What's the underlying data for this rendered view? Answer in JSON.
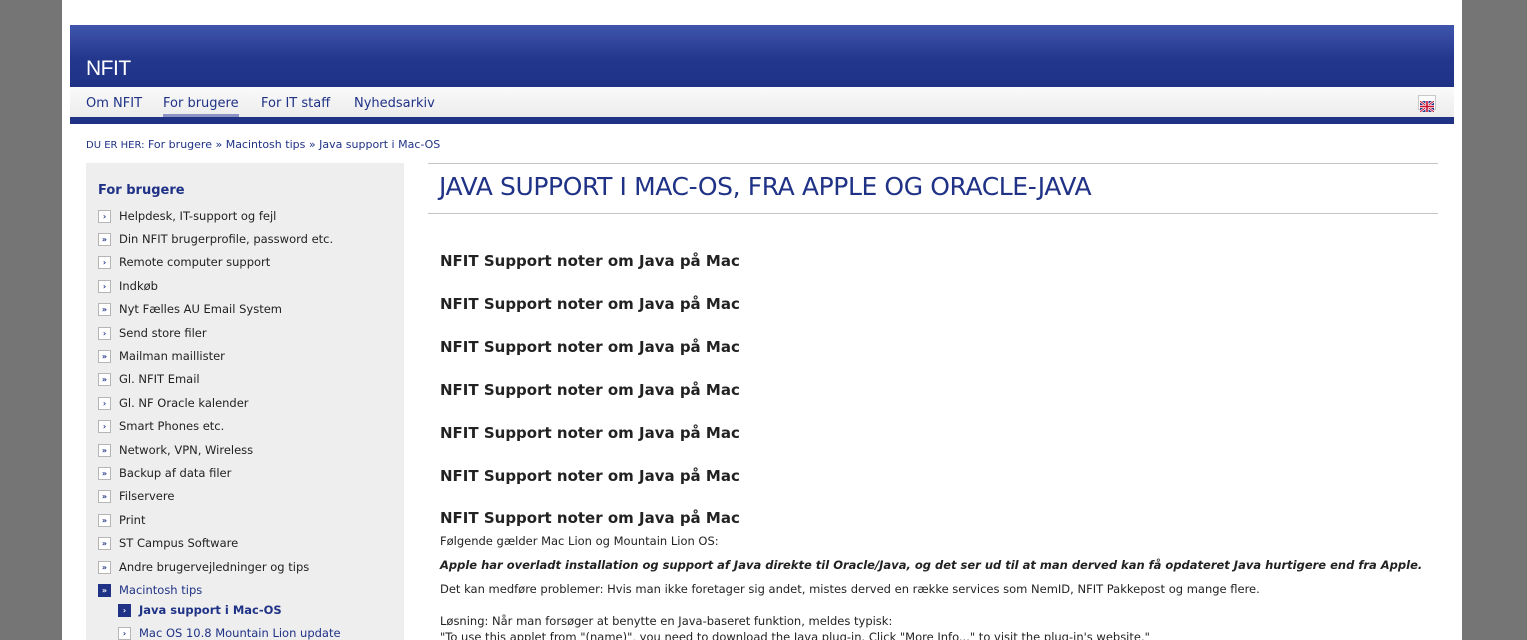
{
  "site": {
    "title": "NFIT"
  },
  "nav": {
    "items": [
      {
        "label": "Om NFIT"
      },
      {
        "label": "For brugere"
      },
      {
        "label": "For IT staff"
      },
      {
        "label": "Nyhedsarkiv"
      }
    ],
    "language_icon": "uk-flag-icon"
  },
  "breadcrumb": {
    "prefix": "DU ER HER:",
    "items": [
      "For brugere",
      "Macintosh tips",
      "Java support i Mac-OS"
    ],
    "separator": "»"
  },
  "sidebar": {
    "title": "For brugere",
    "items": [
      {
        "label": "Helpdesk, IT-support og fejl",
        "icon": "chevron-right-icon"
      },
      {
        "label": "Din NFIT brugerprofile, password etc.",
        "icon": "double-chevron-icon"
      },
      {
        "label": "Remote computer support",
        "icon": "chevron-right-icon"
      },
      {
        "label": "Indkøb",
        "icon": "chevron-right-icon"
      },
      {
        "label": "Nyt Fælles AU Email System",
        "icon": "double-chevron-icon"
      },
      {
        "label": "Send store filer",
        "icon": "chevron-right-icon"
      },
      {
        "label": "Mailman maillister",
        "icon": "double-chevron-icon"
      },
      {
        "label": "Gl. NFIT Email",
        "icon": "double-chevron-icon"
      },
      {
        "label": "Gl. NF Oracle kalender",
        "icon": "chevron-right-icon"
      },
      {
        "label": "Smart Phones etc.",
        "icon": "chevron-right-icon"
      },
      {
        "label": "Network, VPN, Wireless",
        "icon": "double-chevron-icon"
      },
      {
        "label": "Backup af data filer",
        "icon": "double-chevron-icon"
      },
      {
        "label": "Filservere",
        "icon": "double-chevron-icon"
      },
      {
        "label": "Print",
        "icon": "double-chevron-icon"
      },
      {
        "label": "ST Campus Software",
        "icon": "double-chevron-icon"
      },
      {
        "label": "Andre brugervejledninger og tips",
        "icon": "double-chevron-icon"
      },
      {
        "label": "Macintosh tips",
        "icon": "double-chevron-icon"
      }
    ],
    "subitems": [
      {
        "label": "Java support i Mac-OS",
        "icon": "chevron-right-icon"
      },
      {
        "label": "Mac OS 10.8 Mountain Lion update",
        "icon": "chevron-right-icon"
      }
    ]
  },
  "main": {
    "title": "JAVA SUPPORT I MAC-OS, FRA APPLE OG ORACLE-JAVA",
    "note_headings": [
      "NFIT Support noter om Java på Mac",
      "NFIT Support noter om Java på Mac",
      "NFIT Support noter om Java på Mac",
      "NFIT Support noter om Java på Mac",
      "NFIT Support noter om Java på Mac",
      "NFIT Support noter om Java på Mac",
      "NFIT Support noter om Java på Mac"
    ],
    "paragraphs": {
      "intro": "Følgende gælder Mac Lion og Mountain Lion OS:",
      "emphasis": "Apple har overladt installation og support af Java direkte til Oracle/Java, og det ser ud til at man derved kan få opdateret Java hurtigere end fra Apple.",
      "problems": "Det kan medføre problemer: Hvis man ikke foretager sig andet, mistes derved en række services som NemID, NFIT Pakkepost og mange flere.",
      "solution": "Løsning: Når man forsøger at benytte en Java-baseret funktion, meldes typisk:",
      "quote": "\"To use this applet from \"(name)\", you need to download the Java plug-in. Click \"More Info...\" to visit the plug-in's website.\""
    }
  },
  "colors": {
    "brand": "#1f3286",
    "sidebar_bg": "#eeeeee",
    "outer_bg": "#757575"
  }
}
